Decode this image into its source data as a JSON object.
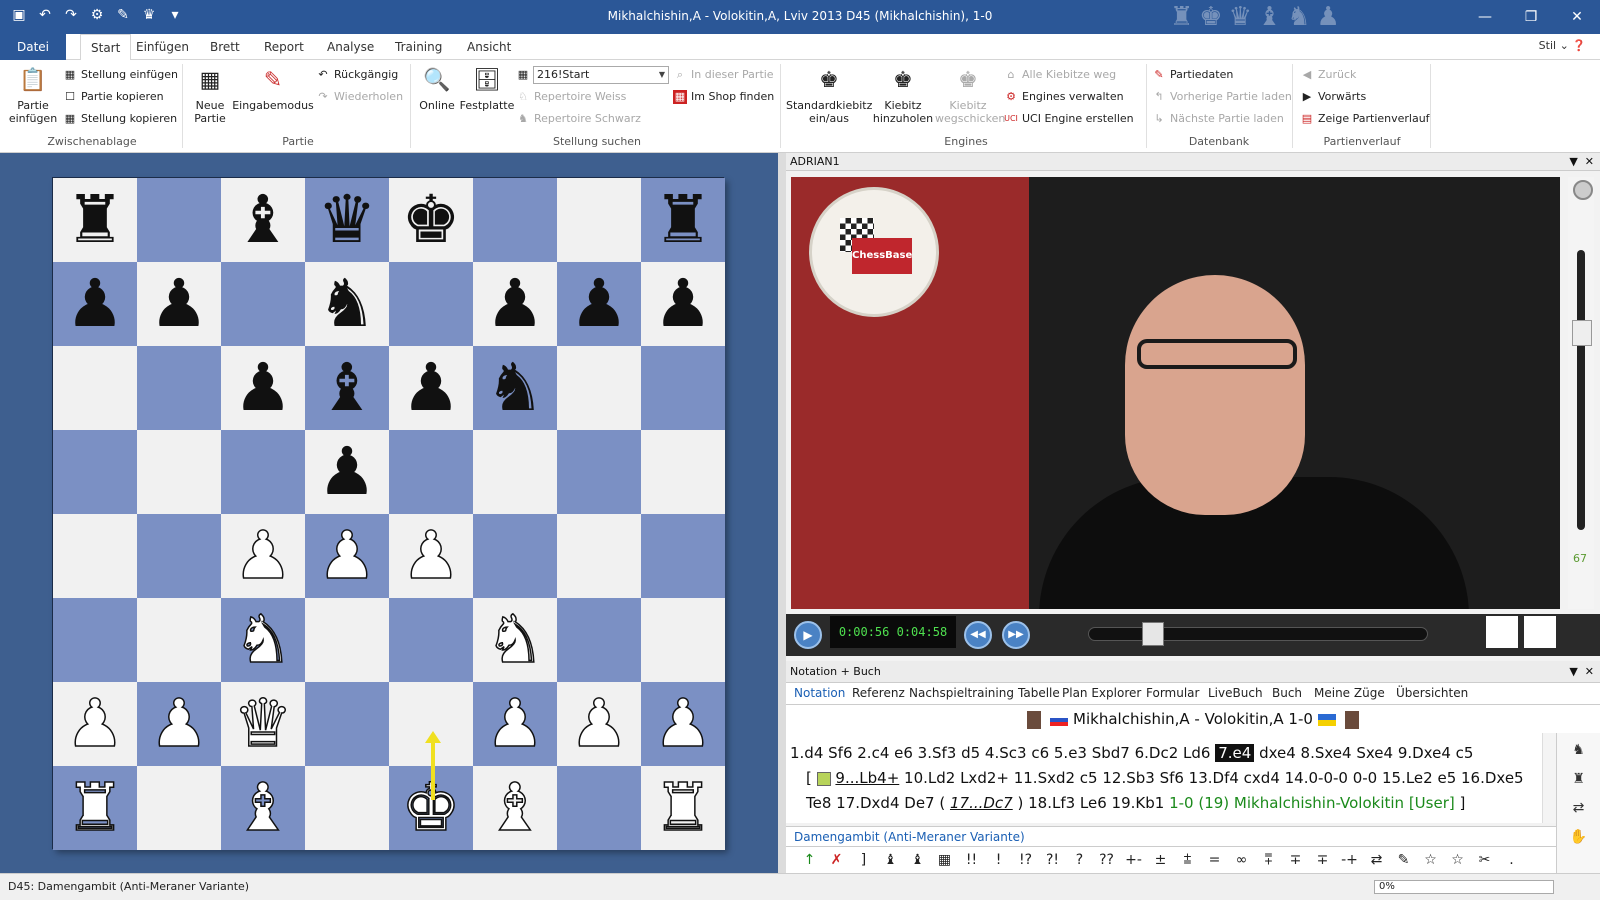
{
  "window": {
    "title": "Mikhalchishin,A - Volokitin,A, Lviv 2013  D45  (Mikhalchishin), 1-0",
    "qat_icons": [
      "save-icon",
      "undo-icon",
      "redo-icon",
      "gear-icon",
      "brush-icon",
      "chess-piece-icon",
      "dropdown-icon"
    ]
  },
  "ribbon_tabs": [
    "Datei",
    "Start",
    "Einfügen",
    "Brett",
    "Report",
    "Analyse",
    "Training",
    "Ansicht"
  ],
  "active_tab": "Start",
  "stil_label": "Stil",
  "ribbon": {
    "zwischenablage": {
      "label": "Zwischenablage",
      "partie_einfuegen": "Partie\neinfügen",
      "stellung_einfuegen": "Stellung einfügen",
      "partie_kopieren": "Partie kopieren",
      "stellung_kopieren": "Stellung kopieren"
    },
    "partie": {
      "label": "Partie",
      "neue_partie": "Neue\nPartie",
      "eingabemodus": "Eingabemodus",
      "rueckgaengig": "Rückgängig",
      "wiederholen": "Wiederholen"
    },
    "stellung_suchen": {
      "label": "Stellung suchen",
      "online": "Online",
      "festplatte": "Festplatte",
      "combo_value": "216!Start",
      "repertoire_weiss": "Repertoire Weiss",
      "repertoire_schwarz": "Repertoire Schwarz",
      "in_dieser_partie": "In dieser Partie",
      "im_shop_finden": "Im Shop finden"
    },
    "engines": {
      "label": "Engines",
      "standardkiebitz": "Standardkiebitz\nein/aus",
      "kiebitz_hinzuholen": "Kiebitz\nhinzuholen",
      "kiebitz_wegschicken": "Kiebitz\nwegschicken",
      "alle_kiebitze_weg": "Alle Kiebitze weg",
      "engines_verwalten": "Engines verwalten",
      "uci_engine_erstellen": "UCI Engine erstellen"
    },
    "datenbank": {
      "label": "Datenbank",
      "partiedaten": "Partiedaten",
      "vorherige_partie": "Vorherige Partie laden",
      "naechste_partie": "Nächste Partie laden"
    },
    "partienverlauf": {
      "label": "Partienverlauf",
      "zurueck": "Zurück",
      "vorwaerts": "Vorwärts",
      "zeige_partienverlauf": "Zeige Partienverlauf"
    }
  },
  "board": {
    "rows": [
      [
        "bR",
        "",
        "bB",
        "bQ",
        "bK",
        "",
        "",
        "bR"
      ],
      [
        "bP",
        "bP",
        "",
        "bN",
        "",
        "bP",
        "bP",
        "bP"
      ],
      [
        "",
        "",
        "bP",
        "bB",
        "bP",
        "bN",
        "",
        ""
      ],
      [
        "",
        "",
        "",
        "bP",
        "",
        "",
        "",
        ""
      ],
      [
        "",
        "",
        "wP",
        "wP",
        "wP",
        "",
        "",
        ""
      ],
      [
        "",
        "",
        "wN",
        "",
        "",
        "wN",
        "",
        ""
      ],
      [
        "wP",
        "wP",
        "wQ",
        "",
        "",
        "wP",
        "wP",
        "wP"
      ],
      [
        "wR",
        "",
        "wB",
        "",
        "wK",
        "wB",
        "",
        "wR"
      ]
    ],
    "last_move": {
      "from": "e3",
      "to": "e4",
      "color": "#f0e020"
    }
  },
  "video_panel": {
    "title": "ADRIAN1",
    "logo_text": "ChessBase",
    "time": "0:00:56 0:04:58",
    "volume": "67",
    "playback_progress": 0.19
  },
  "notation_panel": {
    "title": "Notation + Buch",
    "tabs": [
      "Notation",
      "Referenz",
      "Nachspieltraining",
      "Tabelle",
      "Plan Explorer",
      "Formular",
      "LiveBuch",
      "Buch",
      "Meine Züge",
      "Übersichten"
    ],
    "active_tab": "Notation",
    "game_header": "Mikhalchishin,A - Volokitin,A  1-0",
    "moves_line1_before": "1.d4  Sf6  2.c4  e6  3.Sf3  d5  4.Sc3  c6  5.e3  Sbd7  6.Dc2  Ld6 ",
    "current_move": "7.e4",
    "moves_line1_after": " dxe4  8.Sxe4  Sxe4  9.Dxe4  c5",
    "line2_bracket": "[",
    "line2_var": "9...Lb4+",
    "line2_rest": "  10.Ld2  Lxd2+  11.Sxd2  c5  12.Sb3  Sf6  13.Df4  cxd4  14.0-0-0  0-0  15.Le2  e5  16.Dxe5",
    "line3_start": "Te8  17.Dxd4  De7  ( ",
    "line3_var": "17...Dc7",
    "line3_mid": " )  18.Lf3  Le6  19.Kb1  ",
    "line3_result": "1-0 (19) Mikhalchishin-Volokitin [User]",
    "line3_end": "  ]",
    "opening": "Damengambit (Anti-Meraner Variante)",
    "symbols": [
      "↑",
      "✗",
      "]",
      "♝",
      "♝",
      "▦",
      "!!",
      "!",
      "!?",
      "?!",
      "?",
      "??",
      "+-",
      "±",
      "⩲",
      "=",
      "∞",
      "⩱",
      "∓",
      "∓",
      "-+",
      "⇄",
      "✎",
      "☆",
      "☆",
      "✂",
      "."
    ]
  },
  "status": {
    "text": "D45: Damengambit (Anti-Meraner Variante)",
    "progress": "0%"
  }
}
